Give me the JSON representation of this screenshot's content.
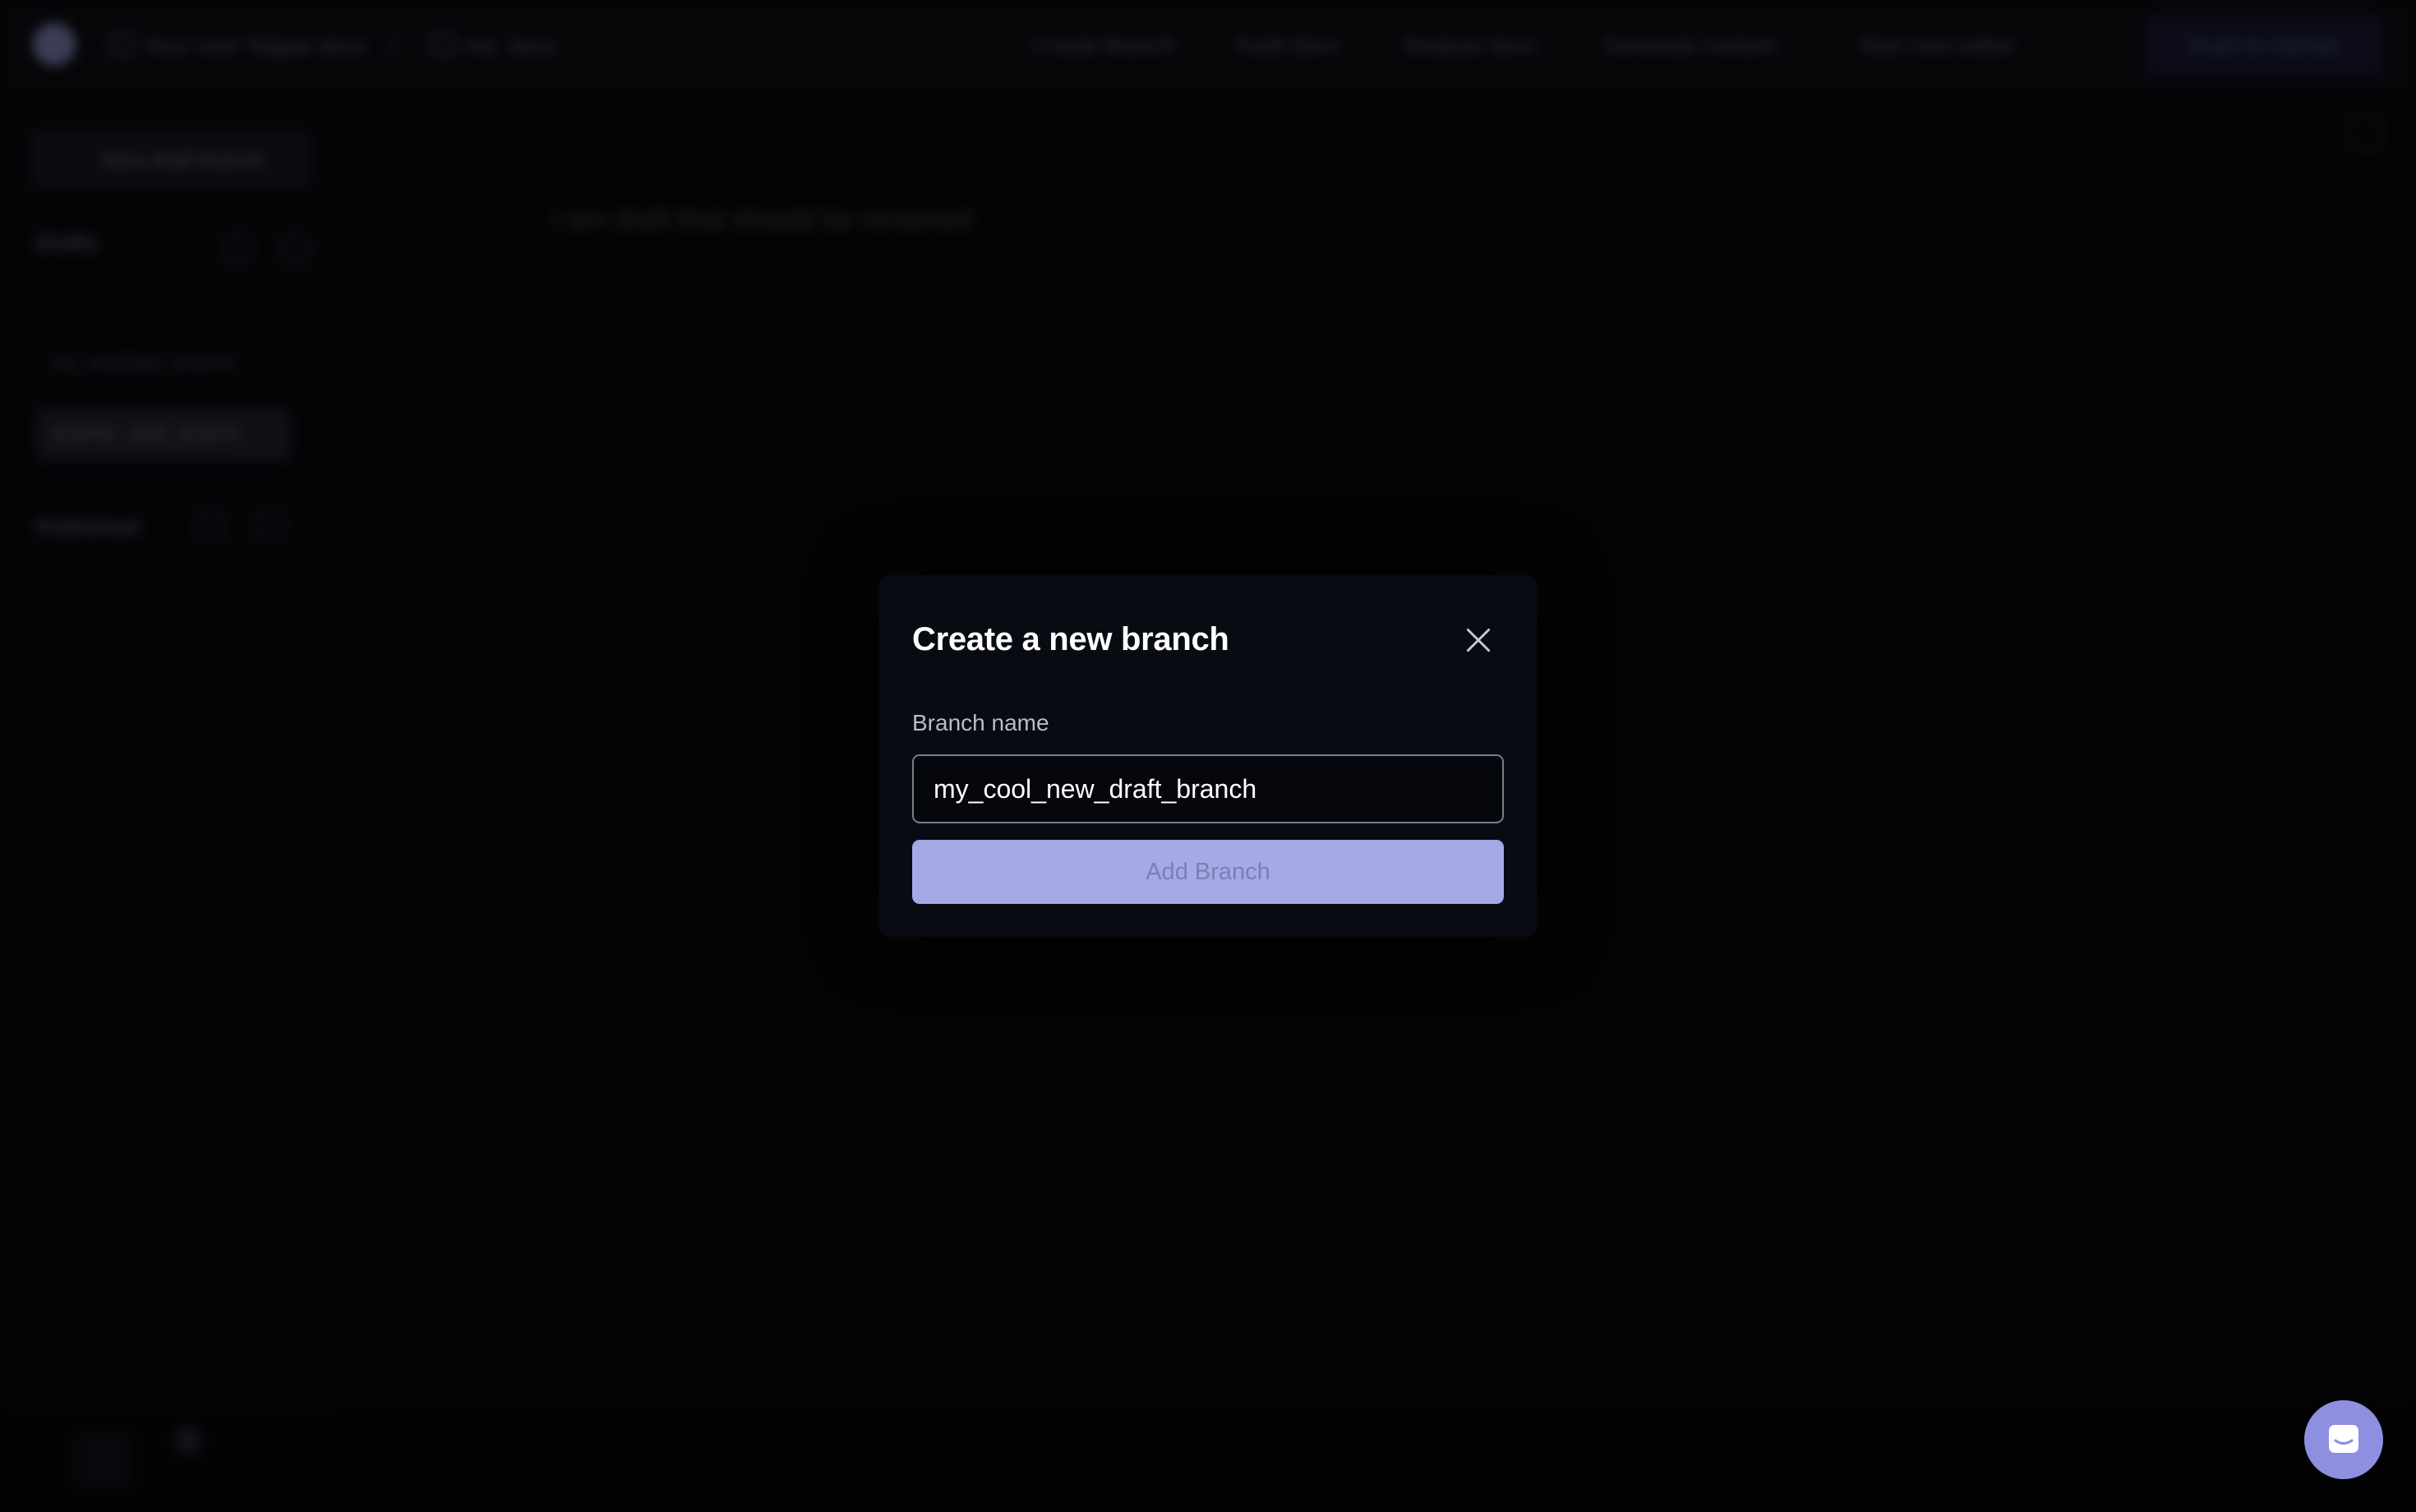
{
  "background": {
    "breadcrumb": {
      "project": "Your new Tolgee docs",
      "file": "md. docs"
    },
    "nav": [
      "Create Branch",
      "Audit docs",
      "Analyze docs",
      "Generate content",
      "Start new editor"
    ],
    "push_button": "Push to GitHub",
    "sidebar": {
      "new_draft_button": "New draft branch",
      "drafts_heading": "Drafts",
      "draft_items": [
        "my_example_branch",
        "another_draft_branch"
      ],
      "published_heading": "Published"
    },
    "main_text": "I am draft that should be renamed"
  },
  "modal": {
    "title": "Create a new branch",
    "close_icon": "close-icon",
    "branch_name_label": "Branch name",
    "branch_name_value": "my_cool_new_draft_branch",
    "add_button_label": "Add Branch"
  },
  "chat_launcher": {
    "icon": "chat-bubble-icon"
  },
  "colors": {
    "modal_bg": "#090b13",
    "accent_button": "#a5a9e6",
    "chat_launcher": "#8d8fe0"
  }
}
